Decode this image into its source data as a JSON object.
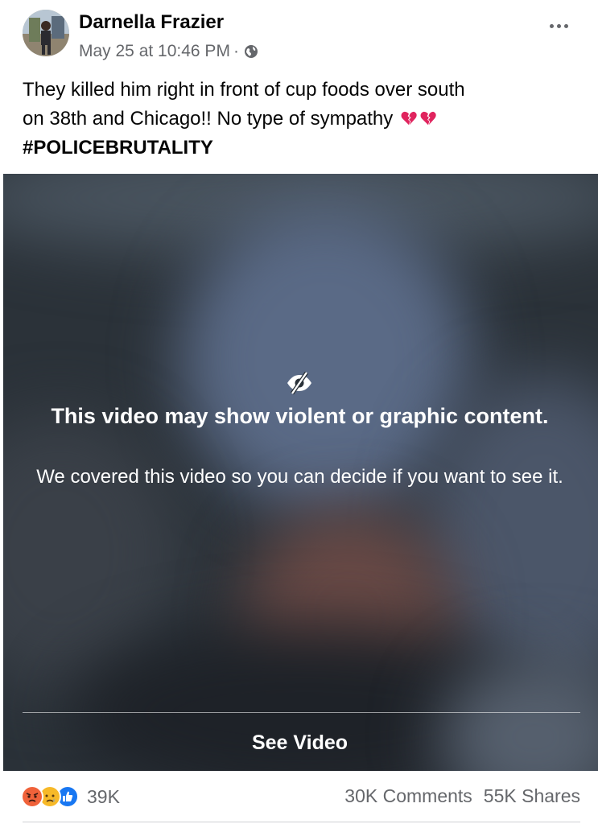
{
  "post": {
    "author": "Darnella Frazier",
    "timestamp": "May 25 at 10:46 PM",
    "separator": "·",
    "audience_icon": "globe-icon",
    "more_icon": "more-options-icon",
    "text_line1": "They killed him right in front of cup foods over south",
    "text_line2": "on 38th and Chicago!! No type of sympathy",
    "hashtag": "#POLICEBRUTALITY",
    "emoji": [
      "broken-heart-icon",
      "broken-heart-icon"
    ]
  },
  "video": {
    "cover_icon": "eye-slash-icon",
    "warning_title": "This video may show violent or graphic content.",
    "warning_subtitle": "We covered this video so you can decide if you want to see it.",
    "see_video_label": "See Video"
  },
  "footer": {
    "reaction_icons": [
      "angry-reaction-icon",
      "sad-reaction-icon",
      "like-reaction-icon"
    ],
    "reaction_count": "39K",
    "comments": "30K Comments",
    "shares": "55K Shares"
  },
  "colors": {
    "text_primary": "#050505",
    "text_secondary": "#65676b",
    "heart_red": "#e0245e",
    "like_blue": "#1877f2",
    "angry_orange": "#f0623a",
    "sad_yellow": "#f7b928"
  }
}
